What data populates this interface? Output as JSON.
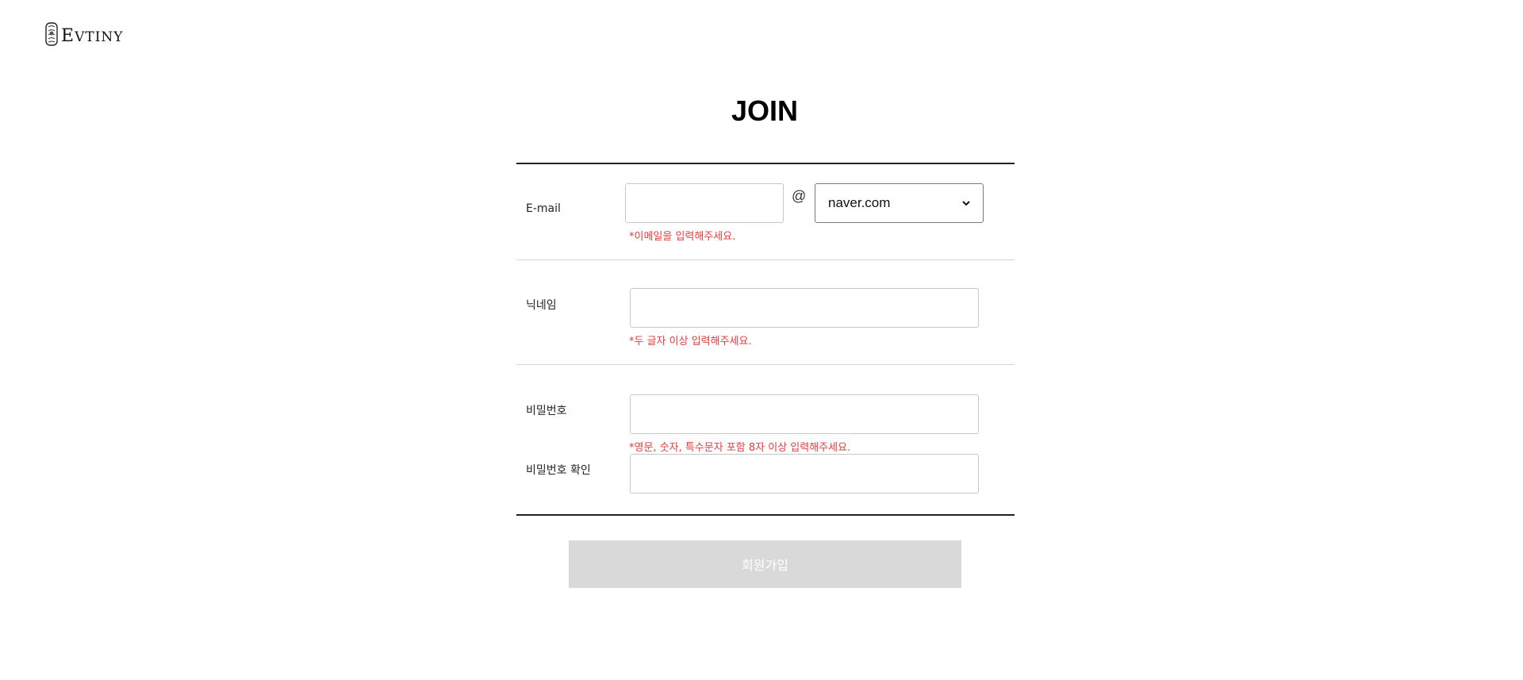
{
  "header": {
    "logo_text_first": "E",
    "logo_text_rest": "VT",
    "logo_text_small": "INY"
  },
  "page": {
    "title": "JOIN"
  },
  "form": {
    "email": {
      "label": "E-mail",
      "value": "",
      "placeholder": "",
      "at_symbol": "@",
      "domain_selected": "naver.com",
      "hint": "*이메일을 입력해주세요."
    },
    "nickname": {
      "label": "닉네임",
      "value": "",
      "placeholder": "",
      "hint": "*두 글자 이상 입력해주세요."
    },
    "password": {
      "label": "비밀번호",
      "value": "",
      "placeholder": "",
      "hint": "*영문, 숫자, 특수문자 포함 8자 이상 입력해주세요."
    },
    "password_confirm": {
      "label": "비밀번호 확인",
      "value": "",
      "placeholder": ""
    },
    "submit_label": "회원가입"
  },
  "colors": {
    "hint": "#e63b3b",
    "submit_disabled_bg": "#d9d9d9",
    "divider_dark": "#222222",
    "divider_light": "#d4d4d4"
  },
  "icons": {
    "logo": "emblem-icon",
    "select_arrow": "chevron-down-icon"
  }
}
